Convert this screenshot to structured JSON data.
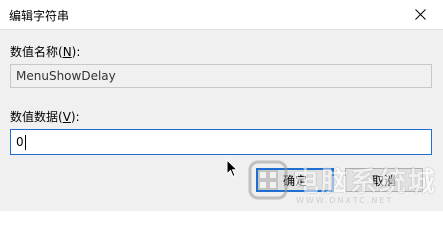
{
  "window": {
    "title": "编辑字符串"
  },
  "fields": {
    "name_label_prefix": "数值名称(",
    "name_label_key": "N",
    "name_label_suffix": "):",
    "name_value": "MenuShowDelay",
    "data_label_prefix": "数值数据(",
    "data_label_key": "V",
    "data_label_suffix": "):",
    "data_value": "0"
  },
  "buttons": {
    "ok": "确定",
    "cancel": "取消"
  },
  "watermark": {
    "text": "电脑系统城",
    "url": "WWW.DNXTC.NET"
  },
  "colors": {
    "accent": "#1e6fd0",
    "dialog_bg": "#f0f0f0",
    "titlebar_bg": "#ffffff"
  },
  "icons": {
    "close": "close-icon",
    "cursor": "mouse-pointer-icon"
  }
}
